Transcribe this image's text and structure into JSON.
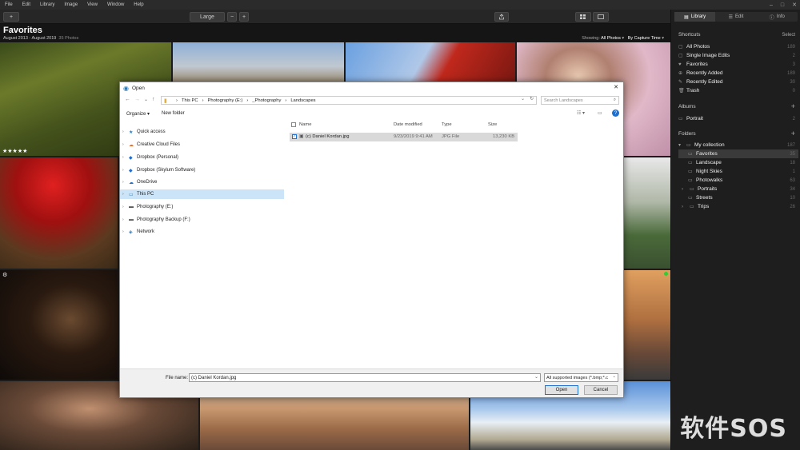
{
  "menubar": {
    "items": [
      "File",
      "Edit",
      "Library",
      "Image",
      "View",
      "Window",
      "Help"
    ],
    "window_controls": [
      "–",
      "□",
      "✕"
    ]
  },
  "toolbar": {
    "add_label": "+",
    "size_label": "Large",
    "minus_label": "−",
    "plus_label": "+"
  },
  "gallery": {
    "title": "Favorites",
    "date_range": "August 2013 - August 2019",
    "photo_count": "35 Photos",
    "showing_label": "Showing:",
    "showing_value": "All Photos",
    "sort_label": "By Capture Time"
  },
  "right_panel": {
    "tabs": [
      {
        "label": "Library"
      },
      {
        "label": "Edit"
      },
      {
        "label": "Info"
      }
    ],
    "shortcuts": {
      "heading": "Shortcuts",
      "action": "Select",
      "items": [
        {
          "label": "All Photos",
          "count": "189"
        },
        {
          "label": "Single Image Edits",
          "count": "2"
        },
        {
          "label": "Favorites",
          "count": "3"
        },
        {
          "label": "Recently Added",
          "count": "189"
        },
        {
          "label": "Recently Edited",
          "count": "30"
        },
        {
          "label": "Trash",
          "count": "0"
        }
      ]
    },
    "albums": {
      "heading": "Albums",
      "add": "+",
      "items": [
        {
          "label": "Portrait",
          "count": "2"
        }
      ]
    },
    "folders": {
      "heading": "Folders",
      "add": "+",
      "items": [
        {
          "label": "My collection",
          "count": "187"
        },
        {
          "label": "Favorites",
          "count": "35"
        },
        {
          "label": "Landscape",
          "count": "18"
        },
        {
          "label": "Night Skies",
          "count": "1"
        },
        {
          "label": "Photowalks",
          "count": "63"
        },
        {
          "label": "Portraits",
          "count": "34"
        },
        {
          "label": "Streets",
          "count": "10"
        },
        {
          "label": "Trips",
          "count": "26"
        }
      ]
    }
  },
  "dialog": {
    "title": "Open",
    "close": "✕",
    "breadcrumb": [
      "This PC",
      "Photography (E:)",
      "_Photography",
      "Landscapes"
    ],
    "search_placeholder": "Search Landscapes",
    "organize": "Organize ▾",
    "new_folder": "New folder",
    "nav_items": [
      {
        "label": "Quick access"
      },
      {
        "label": "Creative Cloud Files"
      },
      {
        "label": "Dropbox (Personal)"
      },
      {
        "label": "Dropbox (Skylum Software)"
      },
      {
        "label": "OneDrive"
      },
      {
        "label": "This PC"
      },
      {
        "label": "Photography (E:)"
      },
      {
        "label": "Photography Backup (F:)"
      },
      {
        "label": "Network"
      }
    ],
    "columns": {
      "name": "Name",
      "date": "Date modified",
      "type": "Type",
      "size": "Size"
    },
    "file": {
      "name": "(c) Daniel Kordan.jpg",
      "date": "9/23/2019 9:41 AM",
      "type": "JPG File",
      "size": "13,230 KB"
    },
    "filename_label": "File name:",
    "filename_value": "(c) Daniel Kordan.jpg",
    "filetype_value": "All supported images (*.bmp;*.c",
    "open_label": "Open",
    "cancel_label": "Cancel"
  },
  "watermark": "软件SOS"
}
